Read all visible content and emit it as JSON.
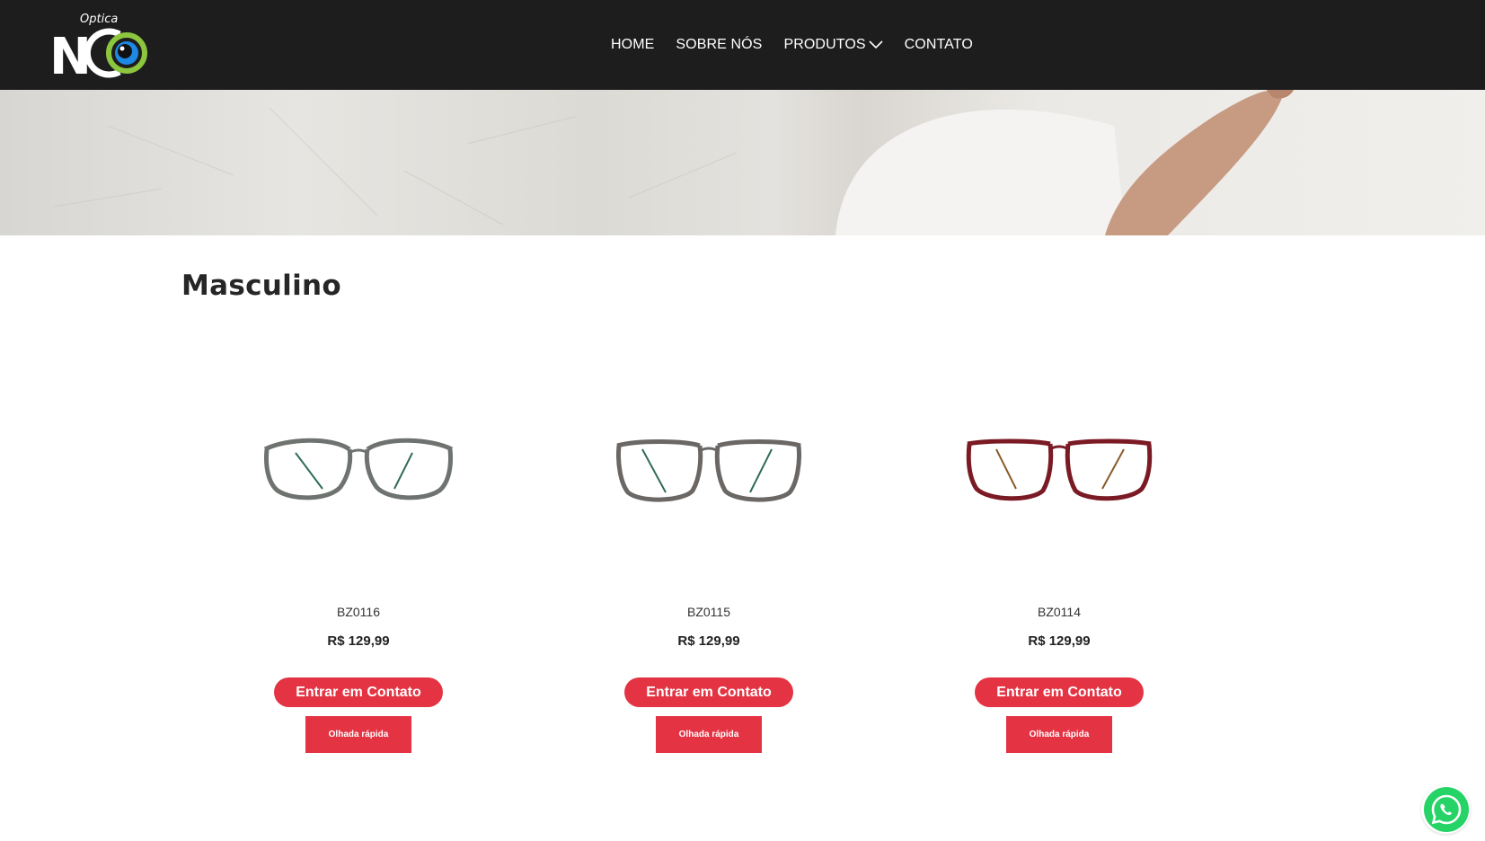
{
  "header": {
    "logo_tag": "Optica",
    "logo_text": "NCO",
    "nav": [
      {
        "label": "HOME"
      },
      {
        "label": "SOBRE NÓS"
      },
      {
        "label": "PRODUTOS"
      },
      {
        "label": "CONTATO"
      }
    ]
  },
  "page": {
    "title": "Masculino"
  },
  "products": [
    {
      "name": "BZ0116",
      "price": "R$ 129,99",
      "contact_label": "Entrar em Contato",
      "quick_label": "Olhada rápida",
      "frame_color": "#6e7370"
    },
    {
      "name": "BZ0115",
      "price": "R$ 129,99",
      "contact_label": "Entrar em Contato",
      "quick_label": "Olhada rápida",
      "frame_color": "#6a6764"
    },
    {
      "name": "BZ0114",
      "price": "R$ 129,99",
      "contact_label": "Entrar em Contato",
      "quick_label": "Olhada rápida",
      "frame_color": "#7a1a24"
    }
  ],
  "colors": {
    "header_bg": "#1d1d1d",
    "accent": "#e43343",
    "logo_green": "#8cc63f",
    "logo_blue": "#1e88e5",
    "whatsapp": "#25d366"
  },
  "icons": {
    "nav_dropdown": "chevron-down-icon",
    "floating": "whatsapp-icon"
  }
}
